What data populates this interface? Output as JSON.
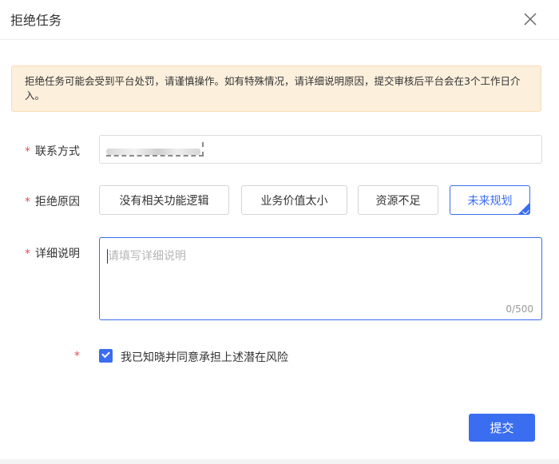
{
  "dialog": {
    "title": "拒绝任务",
    "close_icon": "close-icon"
  },
  "notice": {
    "text": "拒绝任务可能会受到平台处罚，请谨慎操作。如有特殊情况，请详细说明原因，提交审核后平台会在3个工作日介入。",
    "bg_color": "#fcefdc"
  },
  "form": {
    "required_mark": "*",
    "contact": {
      "label": "联系方式"
    },
    "reason": {
      "label": "拒绝原因",
      "options": [
        "没有相关功能逻辑",
        "业务价值太小",
        "资源不足",
        "未来规划"
      ],
      "selected": "未来规划"
    },
    "detail": {
      "label": "详细说明",
      "placeholder": "请填写详细说明",
      "value": "",
      "counter": "0/500"
    },
    "agree": {
      "checked": true,
      "text": "我已知晓并同意承担上述潜在风险"
    }
  },
  "actions": {
    "submit_label": "提交"
  },
  "colors": {
    "primary": "#3a6df0",
    "required": "#e34d59"
  }
}
